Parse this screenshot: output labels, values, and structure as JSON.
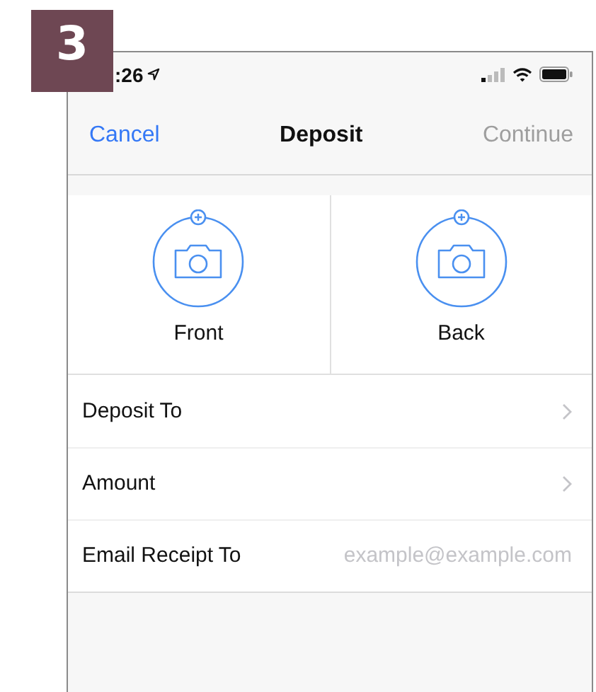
{
  "step_badge": "3",
  "status_bar": {
    "time": ":26"
  },
  "nav": {
    "cancel": "Cancel",
    "title": "Deposit",
    "continue": {
      "label": "Continue",
      "disabled": true
    }
  },
  "captures": [
    {
      "label": "Front"
    },
    {
      "label": "Back"
    }
  ],
  "rows": [
    {
      "kind": "link",
      "label": "Deposit To"
    },
    {
      "kind": "link",
      "label": "Amount"
    },
    {
      "kind": "field",
      "label": "Email Receipt To",
      "placeholder": "example@example.com"
    }
  ]
}
